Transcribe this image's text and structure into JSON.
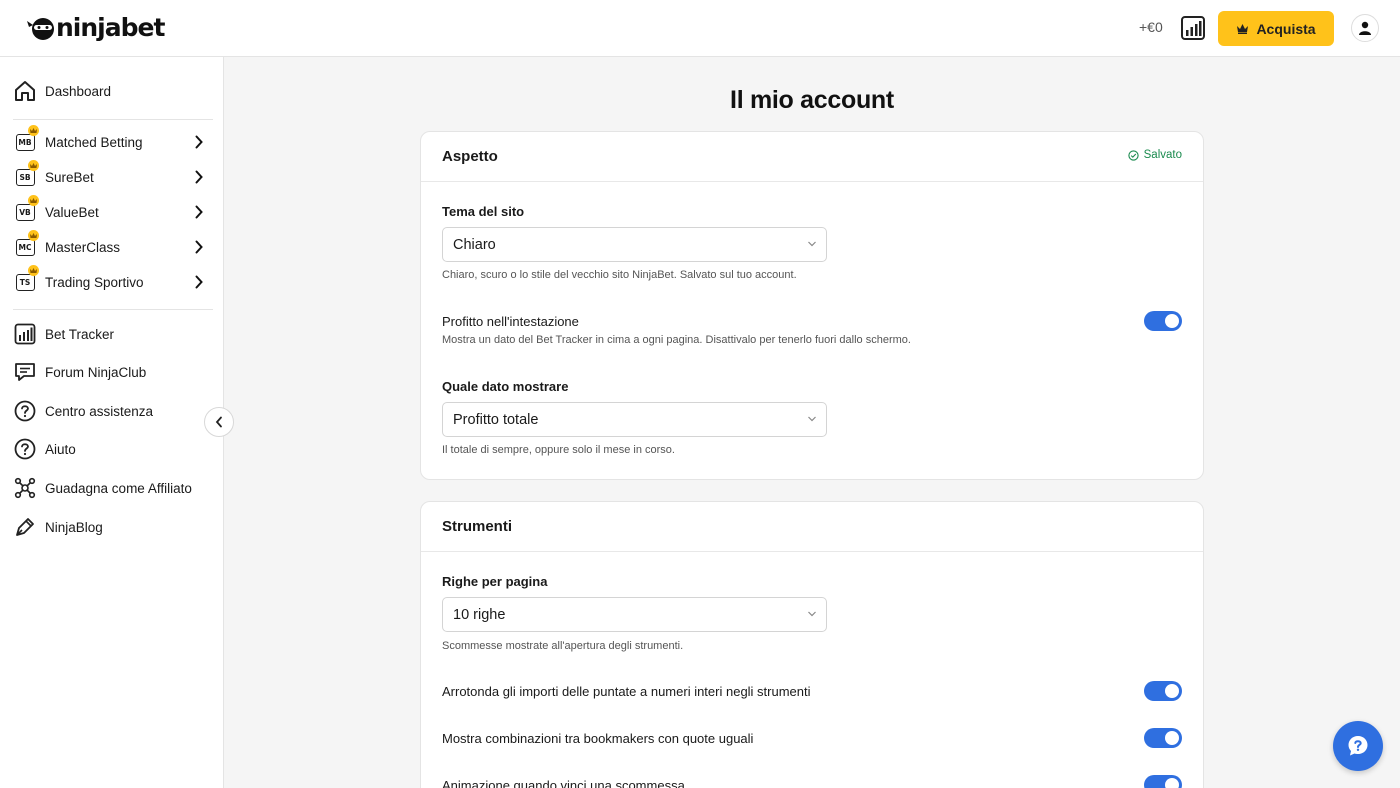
{
  "header": {
    "brand": "ninjabet",
    "profit": "+€0",
    "buy_label": "Acquista"
  },
  "sidebar": {
    "top": [
      {
        "label": "Dashboard",
        "icon": "home-icon"
      }
    ],
    "premium": [
      {
        "label": "Matched Betting",
        "badge": "MB"
      },
      {
        "label": "SureBet",
        "badge": "SB"
      },
      {
        "label": "ValueBet",
        "badge": "VB"
      },
      {
        "label": "MasterClass",
        "badge": "MC"
      },
      {
        "label": "Trading Sportivo",
        "badge": "TS"
      }
    ],
    "bottom": [
      {
        "label": "Bet Tracker",
        "icon": "bar-chart-icon"
      },
      {
        "label": "Forum NinjaClub",
        "icon": "chat-icon"
      },
      {
        "label": "Centro assistenza",
        "icon": "question-icon"
      },
      {
        "label": "Aiuto",
        "icon": "question-icon"
      },
      {
        "label": "Guadagna come Affiliato",
        "icon": "network-icon"
      },
      {
        "label": "NinjaBlog",
        "icon": "pen-icon"
      }
    ]
  },
  "main": {
    "title": "Il mio account",
    "appearance": {
      "title": "Aspetto",
      "saved": "Salvato",
      "theme_label": "Tema del sito",
      "theme_value": "Chiaro",
      "theme_help": "Chiaro, scuro o lo stile del vecchio sito NinjaBet. Salvato sul tuo account.",
      "header_profit_label": "Profitto nell'intestazione",
      "header_profit_help": "Mostra un dato del Bet Tracker in cima a ogni pagina. Disattivalo per tenerlo fuori dallo schermo.",
      "header_profit_on": true,
      "stat_label": "Quale dato mostrare",
      "stat_value": "Profitto totale",
      "stat_help": "Il totale di sempre, oppure solo il mese in corso."
    },
    "tools": {
      "title": "Strumenti",
      "rows_label": "Righe per pagina",
      "rows_value": "10 righe",
      "rows_help": "Scommesse mostrate all'apertura degli strumenti.",
      "toggles": [
        {
          "label": "Arrotonda gli importi delle puntate a numeri interi negli strumenti",
          "on": true
        },
        {
          "label": "Mostra combinazioni tra bookmakers con quote uguali",
          "on": true
        },
        {
          "label": "Animazione quando vinci una scommessa",
          "on": true
        }
      ]
    }
  },
  "colors": {
    "accent": "#2f6fe0",
    "buy": "#ffc21a",
    "saved": "#1a8a4e"
  }
}
